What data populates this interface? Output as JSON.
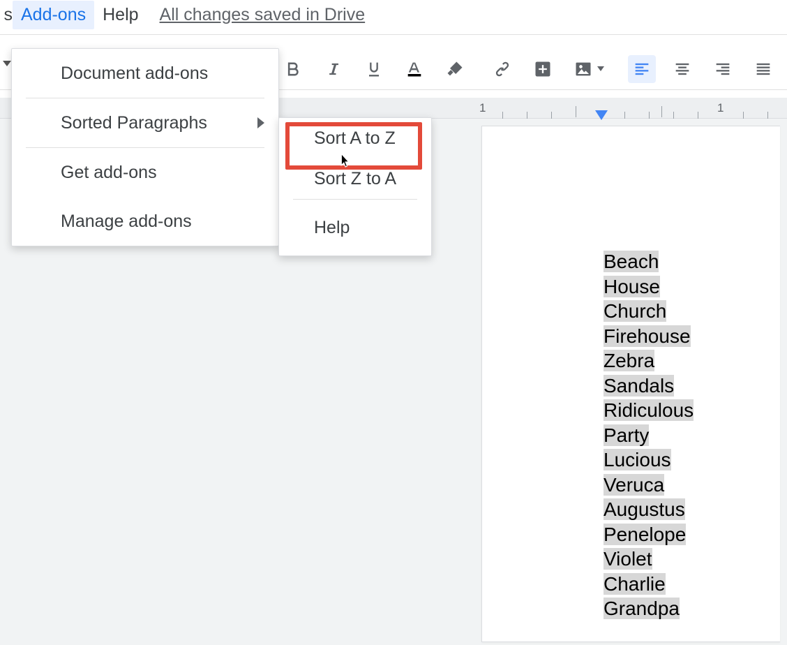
{
  "menubar": {
    "cut_char": "s",
    "addons_label": "Add-ons",
    "help_label": "Help",
    "save_status": "All changes saved in Drive"
  },
  "toolbar": {
    "icons": {
      "bold": "B",
      "italic": "I",
      "underline": "U"
    }
  },
  "addons_menu": {
    "document_addons": "Document add-ons",
    "sorted_paragraphs": "Sorted Paragraphs",
    "get_addons": "Get add-ons",
    "manage_addons": "Manage add-ons"
  },
  "submenu": {
    "sort_az": "Sort A to Z",
    "sort_za": "Sort Z to A",
    "help": "Help"
  },
  "ruler": {
    "num1": "1",
    "num2": "1"
  },
  "document": {
    "words": [
      "Beach",
      "House",
      "Church",
      "Firehouse",
      "Zebra",
      "Sandals",
      "Ridiculous",
      "Party",
      "Lucious",
      "Veruca",
      "Augustus",
      "Penelope",
      "Violet",
      "Charlie",
      "Grandpa"
    ]
  }
}
